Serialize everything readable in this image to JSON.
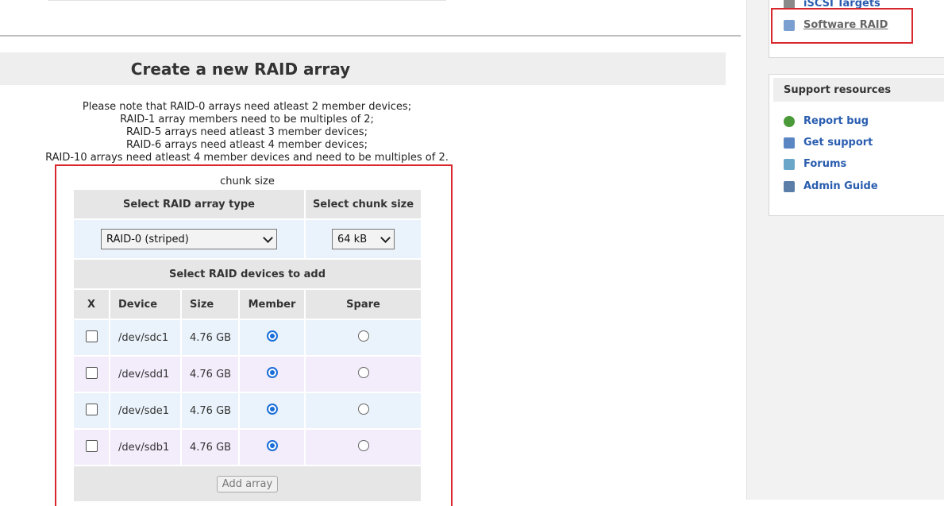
{
  "page_title": "Create a new RAID array",
  "notes": [
    "Please note that RAID-0 arrays need atleast 2 member devices;",
    "RAID-1 array members need to be multiples of 2;",
    "RAID-5 arrays need atleast 3 member devices;",
    "RAID-6 arrays need atleast 4 member devices;",
    "RAID-10 arrays need atleast 4 member devices and need to be multiples of 2."
  ],
  "form": {
    "caption": "chunk size",
    "type_header": "Select RAID array type",
    "chunk_header": "Select chunk size",
    "type_value": "RAID-0 (striped)",
    "chunk_value": "64 kB",
    "devices_header": "Select RAID devices to add",
    "columns": [
      "X",
      "Device",
      "Size",
      "Member",
      "Spare"
    ],
    "devices": [
      {
        "device": "/dev/sdc1",
        "size": "4.76 GB",
        "selected": false,
        "role": "Member"
      },
      {
        "device": "/dev/sdd1",
        "size": "4.76 GB",
        "selected": false,
        "role": "Member"
      },
      {
        "device": "/dev/sde1",
        "size": "4.76 GB",
        "selected": false,
        "role": "Member"
      },
      {
        "device": "/dev/sdb1",
        "size": "4.76 GB",
        "selected": false,
        "role": "Member"
      }
    ],
    "submit_label": "Add array"
  },
  "sidebar": {
    "nav": {
      "iscsi_label": "iSCSI Targets",
      "raid_label": "Software RAID"
    },
    "support": {
      "title": "Support resources",
      "items": [
        "Report bug",
        "Get support",
        "Forums",
        "Admin Guide"
      ]
    }
  },
  "colors": {
    "accent_link": "#2a5db0",
    "highlight_border": "#d9272e",
    "radio": "#1a6ed8"
  }
}
